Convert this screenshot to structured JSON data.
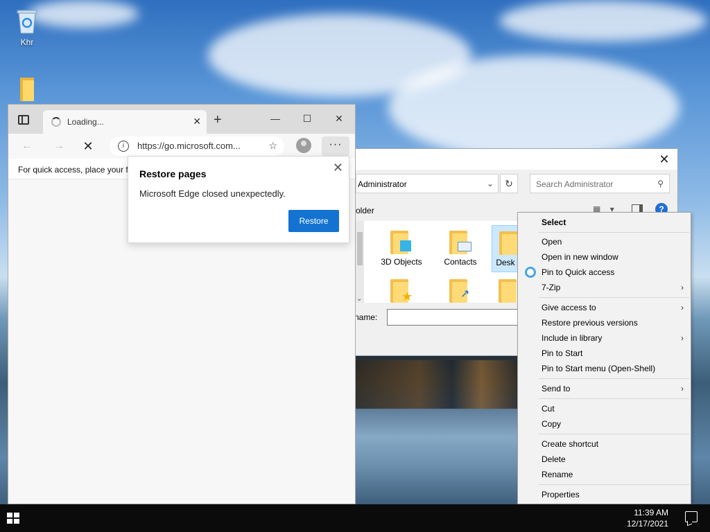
{
  "desktop": {
    "icons": [
      {
        "label": "Khr",
        "icon": "recycle-bin-icon"
      },
      {
        "label": "",
        "icon": "folder-icon"
      }
    ]
  },
  "edge": {
    "tab_title": "Loading...",
    "url": "https://go.microsoft.com...",
    "favorites_bar_text": "For quick access, place your f",
    "more_label": "···",
    "restore_popup": {
      "title": "Restore pages",
      "message": "Microsoft Edge closed unexpectedly.",
      "button": "Restore"
    }
  },
  "explorer": {
    "address": "Administrator",
    "search_placeholder": "Search Administrator",
    "toolbar_text": "older",
    "folders": [
      "3D Objects",
      "Contacts",
      "Desk"
    ],
    "file_name_label": "e name:",
    "file_name_value": ""
  },
  "context_menu": {
    "items": [
      {
        "label": "Select",
        "bold": true
      },
      {
        "label": "Open"
      },
      {
        "label": "Open in new window"
      },
      {
        "label": "Pin to Quick access"
      },
      {
        "label": "7-Zip",
        "submenu": true
      },
      {
        "label": "Give access to",
        "submenu": true
      },
      {
        "label": "Restore previous versions"
      },
      {
        "label": "Include in library",
        "submenu": true
      },
      {
        "label": "Pin to Start"
      },
      {
        "label": "Pin to Start menu (Open-Shell)"
      },
      {
        "label": "Send to",
        "submenu": true
      },
      {
        "label": "Cut"
      },
      {
        "label": "Copy"
      },
      {
        "label": "Create shortcut"
      },
      {
        "label": "Delete"
      },
      {
        "label": "Rename"
      },
      {
        "label": "Properties"
      }
    ]
  },
  "taskbar": {
    "time": "11:39 AM",
    "date": "12/17/2021"
  },
  "colors": {
    "accent": "#1473d0",
    "taskbar": "#0b0b0b",
    "menu_bg": "#f2f2f2"
  }
}
